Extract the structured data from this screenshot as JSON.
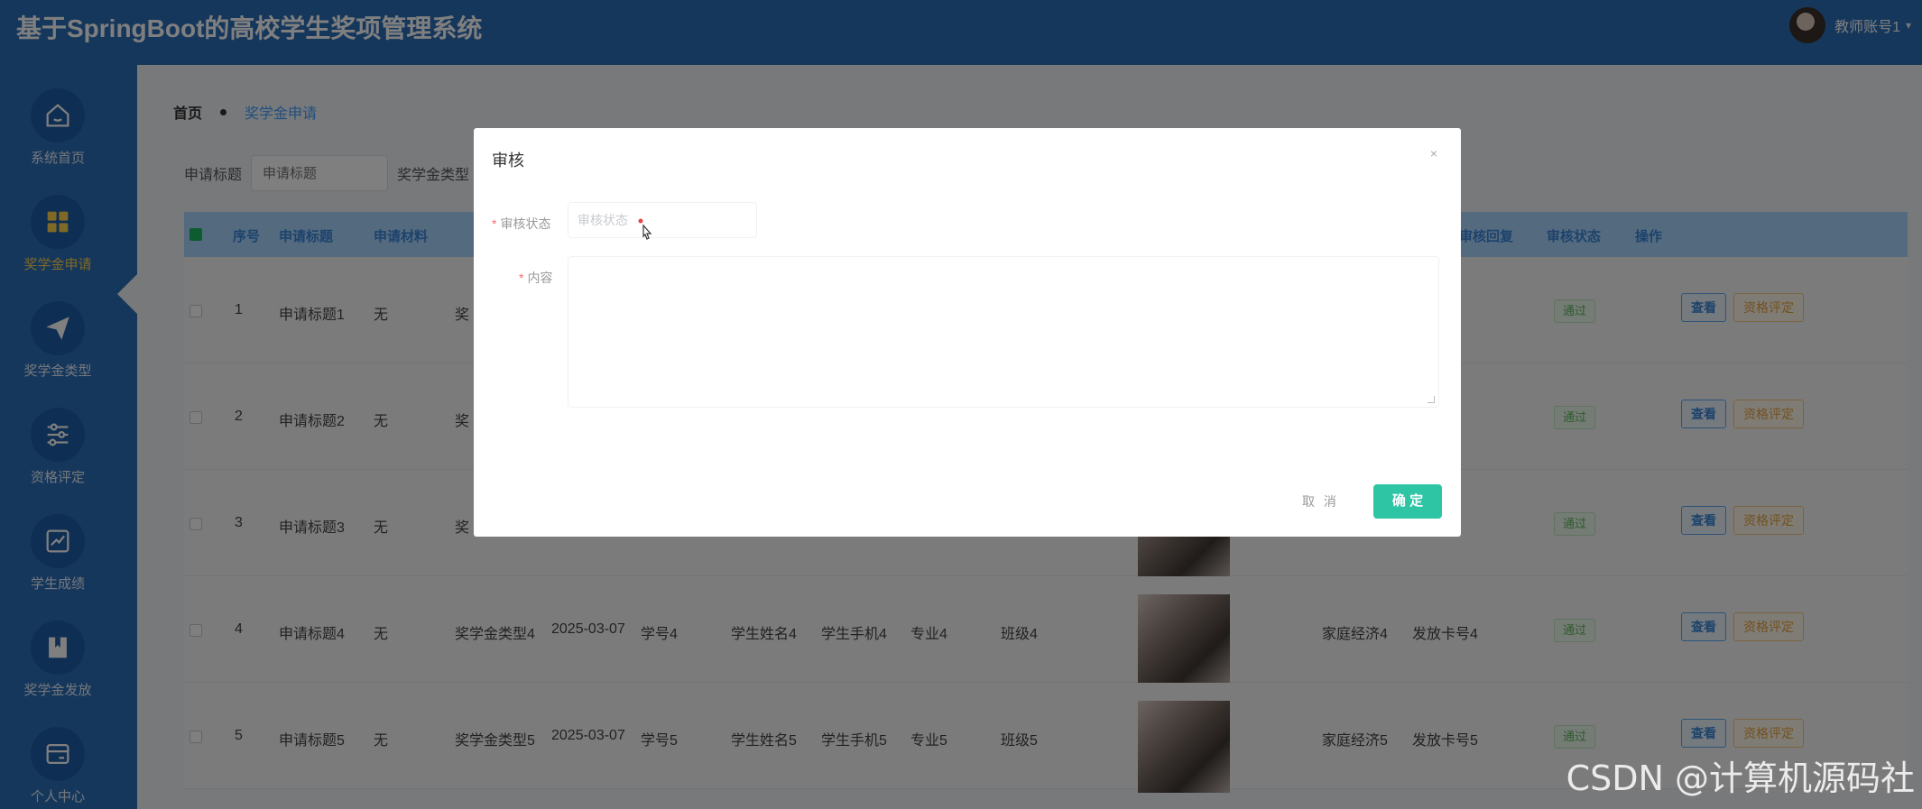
{
  "app": {
    "title": "基于SpringBoot的高校学生奖项管理系统"
  },
  "user": {
    "name": "教师账号1",
    "caret": "▾"
  },
  "sidebar": {
    "items": [
      {
        "label": "系统首页",
        "icon": "home-icon"
      },
      {
        "label": "奖学金申请",
        "icon": "grid-icon",
        "active": true
      },
      {
        "label": "奖学金类型",
        "icon": "paper-plane-icon"
      },
      {
        "label": "资格评定",
        "icon": "sliders-icon"
      },
      {
        "label": "学生成绩",
        "icon": "chart-line-icon"
      },
      {
        "label": "奖学金发放",
        "icon": "book-icon"
      },
      {
        "label": "个人中心",
        "icon": "card-icon"
      }
    ]
  },
  "breadcrumb": {
    "home": "首页",
    "current": "奖学金申请"
  },
  "filters": {
    "title_label": "申请标题",
    "title_placeholder": "申请标题",
    "type_label": "奖学金类型"
  },
  "table": {
    "headers": {
      "index": "序号",
      "title": "申请标题",
      "material": "申请材料",
      "review_reply": "审核回复",
      "review_status": "审核状态",
      "actions": "操作"
    },
    "rows": [
      {
        "index": "1",
        "title": "申请标题1",
        "material": "无",
        "type": "奖",
        "status": "通过",
        "view": "查看",
        "evaluate": "资格评定"
      },
      {
        "index": "2",
        "title": "申请标题2",
        "material": "无",
        "type": "奖",
        "status": "通过",
        "view": "查看",
        "evaluate": "资格评定"
      },
      {
        "index": "3",
        "title": "申请标题3",
        "material": "无",
        "type": "奖",
        "status": "通过",
        "view": "查看",
        "evaluate": "资格评定"
      },
      {
        "index": "4",
        "title": "申请标题4",
        "material": "无",
        "type": "奖学金类型4",
        "date": "2025-03-07",
        "student_no": "学号4",
        "student_name": "学生姓名4",
        "phone": "学生手机4",
        "major": "专业4",
        "class": "班级4",
        "family": "家庭经济4",
        "card": "发放卡号4",
        "status": "通过",
        "view": "查看",
        "evaluate": "资格评定"
      },
      {
        "index": "5",
        "title": "申请标题5",
        "material": "无",
        "type": "奖学金类型5",
        "date": "2025-03-07",
        "student_no": "学号5",
        "student_name": "学生姓名5",
        "phone": "学生手机5",
        "major": "专业5",
        "class": "班级5",
        "family": "家庭经济5",
        "card": "发放卡号5",
        "status": "通过",
        "view": "查看",
        "evaluate": "资格评定"
      }
    ]
  },
  "modal": {
    "title": "审核",
    "close": "×",
    "status_label": "审核状态",
    "status_placeholder": "审核状态",
    "content_label": "内容",
    "cancel": "取 消",
    "confirm": "确 定"
  },
  "watermark": "CSDN @计算机源码社"
}
